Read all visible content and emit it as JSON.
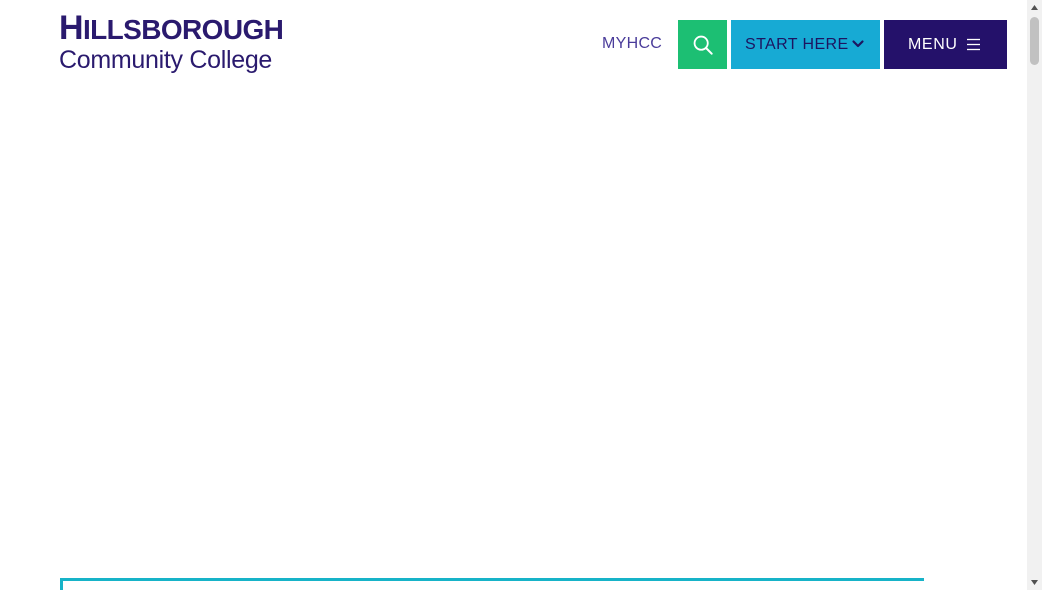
{
  "header": {
    "logo": {
      "line1_initial": "H",
      "line1_rest": "ILLSBOROUGH",
      "line2": "Community College"
    },
    "myhcc_link": "MYHCC",
    "search_icon": "search-icon",
    "start_here": {
      "label": "START HERE",
      "icon": "chevron-down-icon"
    },
    "menu": {
      "label": "MENU",
      "icon": "hamburger-menu-icon"
    }
  },
  "colors": {
    "brand_purple": "#24116a",
    "search_green": "#1cbf73",
    "start_here_blue": "#17aad4",
    "accent_teal": "#17b3c8",
    "link_purple": "#4a3c9a"
  },
  "scrollbar": {
    "up_icon": "arrow-up-icon",
    "down_icon": "arrow-down-icon"
  }
}
